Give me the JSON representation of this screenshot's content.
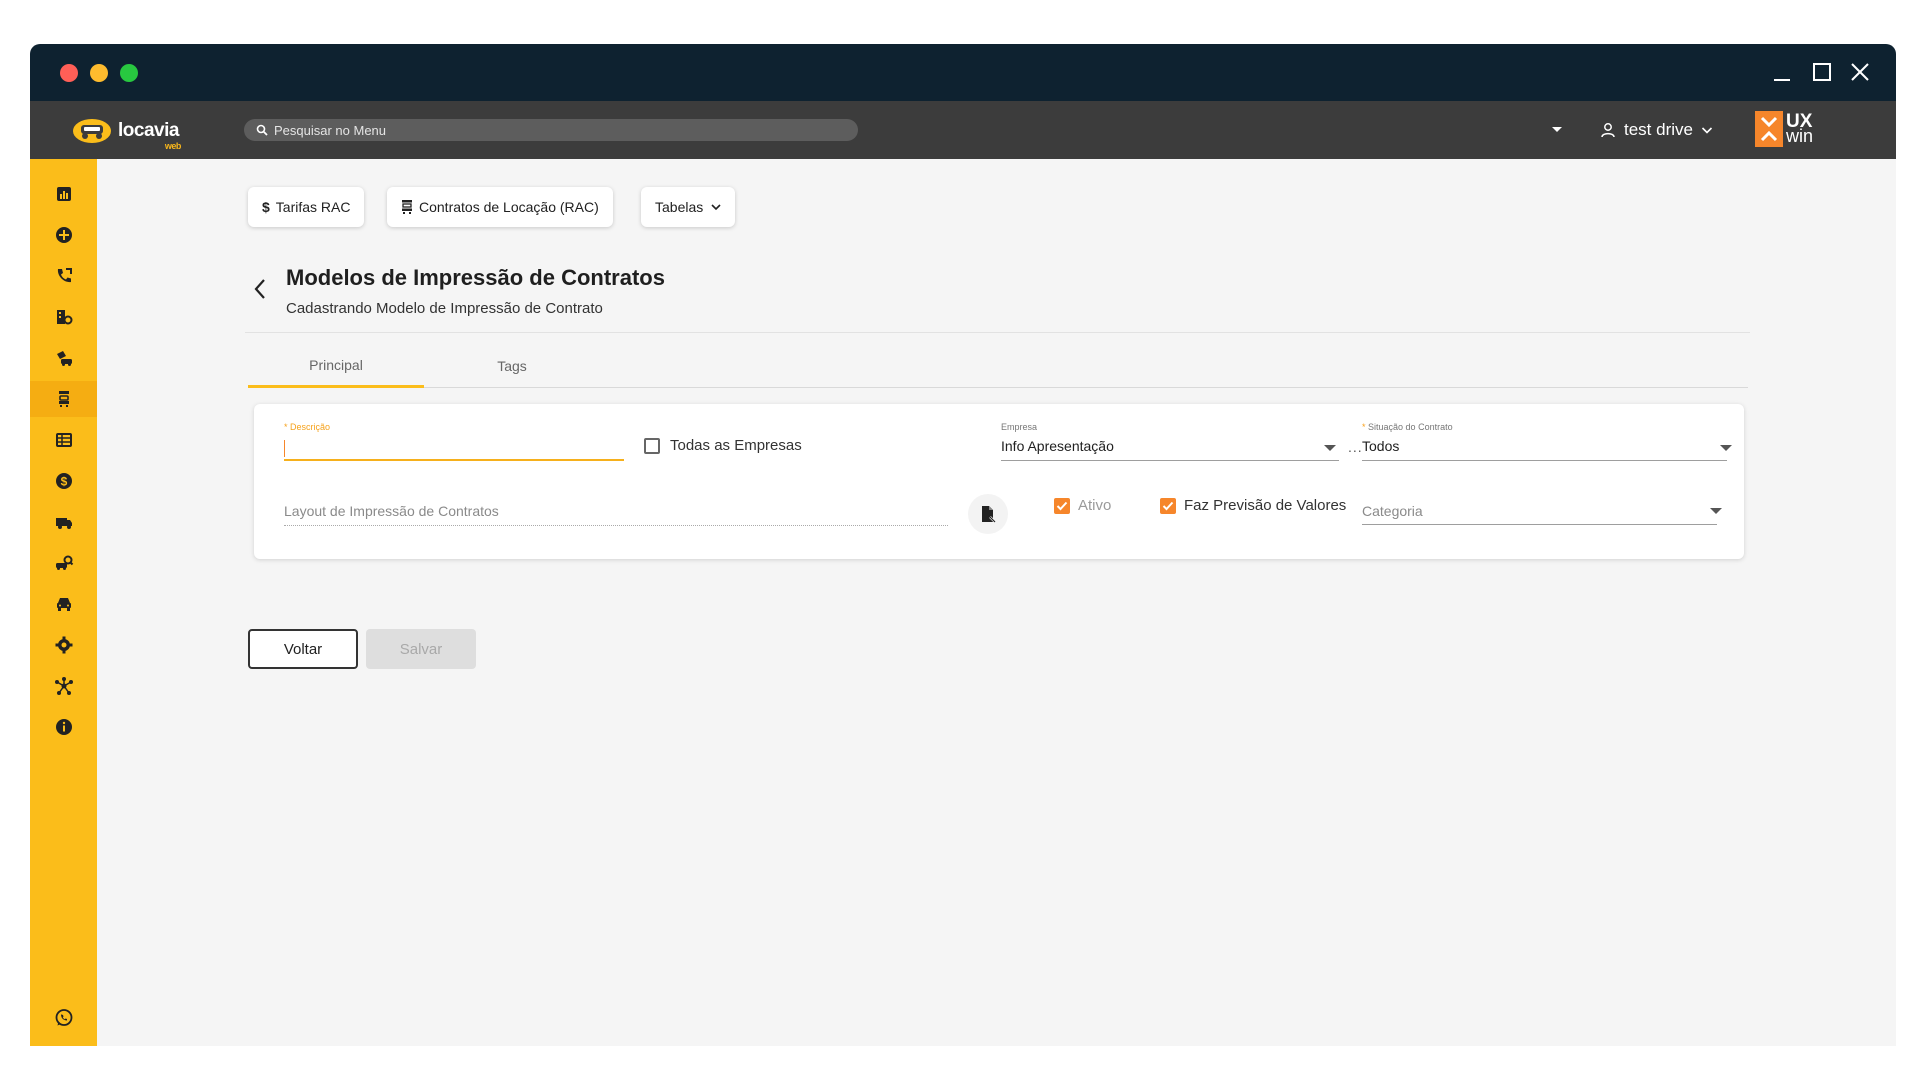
{
  "header": {
    "logo_text": "locavia",
    "logo_sub": "web",
    "search_placeholder": "Pesquisar no Menu",
    "user_name": "test drive",
    "brand_ux": "UX",
    "brand_win": "win"
  },
  "sidebar": {
    "items": [
      {
        "icon": "chart-icon"
      },
      {
        "icon": "add-circle-icon"
      },
      {
        "icon": "phone-icon"
      },
      {
        "icon": "building-icon"
      },
      {
        "icon": "car-rental-icon"
      },
      {
        "icon": "contracts-icon",
        "active": true
      },
      {
        "icon": "table-icon"
      },
      {
        "icon": "dollar-icon"
      },
      {
        "icon": "truck-icon"
      },
      {
        "icon": "car-search-icon"
      },
      {
        "icon": "car-icon"
      },
      {
        "icon": "gear-icon"
      },
      {
        "icon": "network-icon"
      },
      {
        "icon": "info-icon"
      },
      {
        "icon": "whatsapp-icon"
      }
    ],
    "accent": "#fbbd1a"
  },
  "shortcuts": {
    "tarifas": "Tarifas RAC",
    "tarifas_icon": "$",
    "contratos": "Contratos de Locação (RAC)",
    "tabelas": "Tabelas"
  },
  "page": {
    "title": "Modelos de Impressão de Contratos",
    "subtitle": "Cadastrando Modelo de Impressão de Contrato"
  },
  "tabs": [
    {
      "label": "Principal",
      "active": true
    },
    {
      "label": "Tags",
      "active": false
    }
  ],
  "form": {
    "descricao_label": "Descrição",
    "descricao_value": "",
    "todas_empresas_label": "Todas as Empresas",
    "todas_empresas_checked": false,
    "empresa_label": "Empresa",
    "empresa_value": "Info Apresentação",
    "empresa_more": "...",
    "situacao_label": "Situação do Contrato",
    "situacao_value": "Todos",
    "layout_placeholder": "Layout de Impressão de Contratos",
    "ativo_label": "Ativo",
    "ativo_checked": true,
    "previsao_label": "Faz Previsão de Valores",
    "previsao_checked": true,
    "categoria_placeholder": "Categoria",
    "required_mark": "*"
  },
  "actions": {
    "back": "Voltar",
    "save": "Salvar"
  }
}
